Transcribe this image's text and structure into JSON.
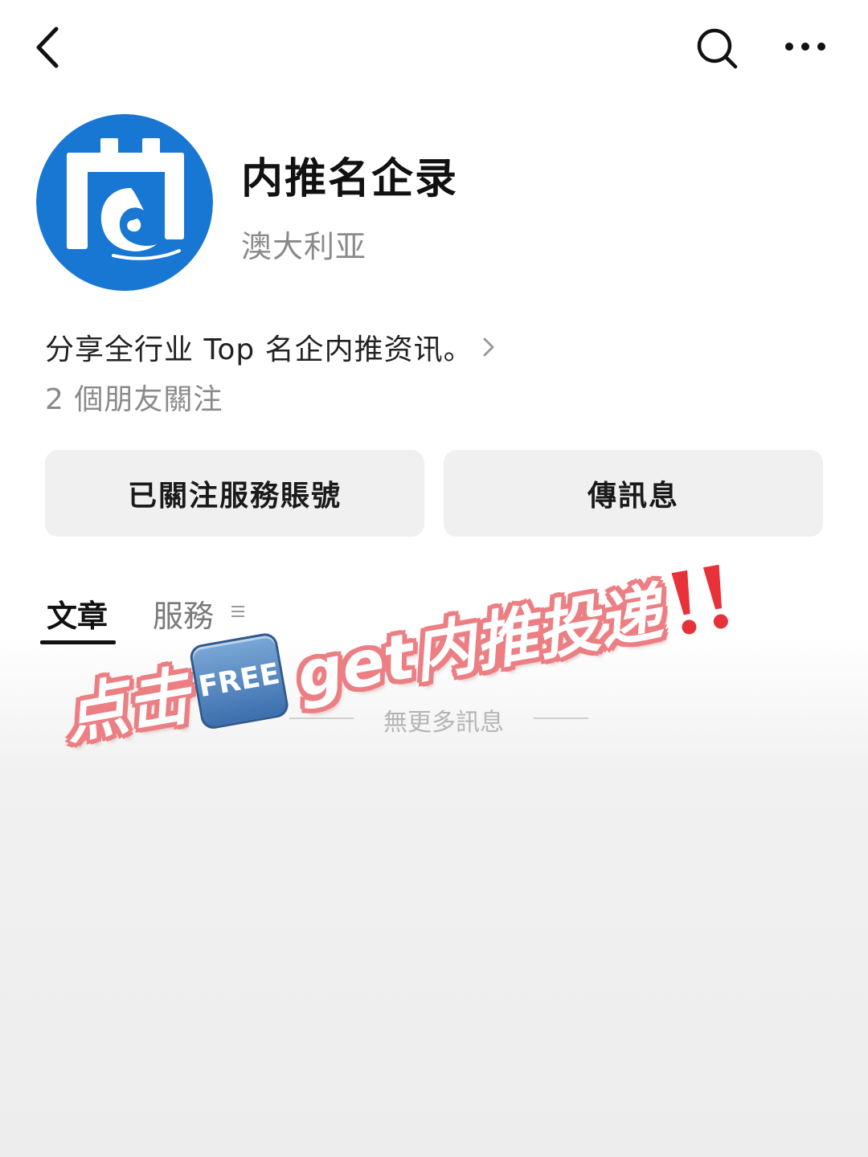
{
  "account": {
    "name": "内推名企录",
    "region": "澳大利亚",
    "description": "分享全行业 Top 名企内推资讯。",
    "followers_text": "2 個朋友關注"
  },
  "actions": {
    "follow_label": "已關注服務賬號",
    "message_label": "傳訊息"
  },
  "tabs": [
    {
      "label": "文章",
      "active": true
    },
    {
      "label": "服務",
      "active": false
    }
  ],
  "empty_state": {
    "text": "無更多訊息"
  },
  "overlay": {
    "prefix": "点击",
    "badge": "FREE",
    "suffix": "get内推投递"
  },
  "icons": {
    "back": "chevron-left-icon",
    "search": "search-icon",
    "more": "more-dots-icon",
    "menu": "menu-lines-icon",
    "alarm": "double-exclamation-icon"
  },
  "colors": {
    "logo_blue": "#1877d2",
    "overlay_outline": "#ec7f83",
    "alarm_red": "#e8323a",
    "button_bg": "#f0f0f0"
  }
}
